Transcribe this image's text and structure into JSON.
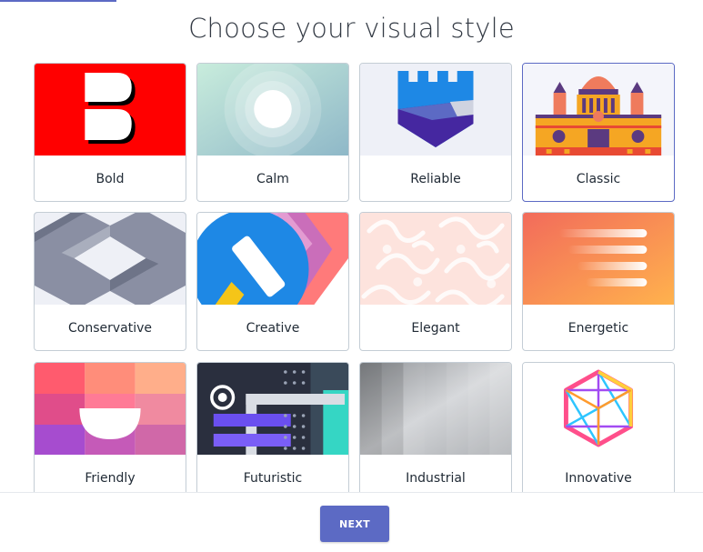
{
  "header": {
    "title": "Choose your visual style"
  },
  "styles": [
    {
      "label": "Bold",
      "selected": false
    },
    {
      "label": "Calm",
      "selected": false
    },
    {
      "label": "Reliable",
      "selected": false
    },
    {
      "label": "Classic",
      "selected": true
    },
    {
      "label": "Conservative",
      "selected": false
    },
    {
      "label": "Creative",
      "selected": false
    },
    {
      "label": "Elegant",
      "selected": false
    },
    {
      "label": "Energetic",
      "selected": false
    },
    {
      "label": "Friendly",
      "selected": false
    },
    {
      "label": "Futuristic",
      "selected": false
    },
    {
      "label": "Industrial",
      "selected": false
    },
    {
      "label": "Innovative",
      "selected": false
    }
  ],
  "footer": {
    "next_label": "NEXT"
  },
  "colors": {
    "accent": "#5c6ac4",
    "border": "#c4cdd5"
  }
}
